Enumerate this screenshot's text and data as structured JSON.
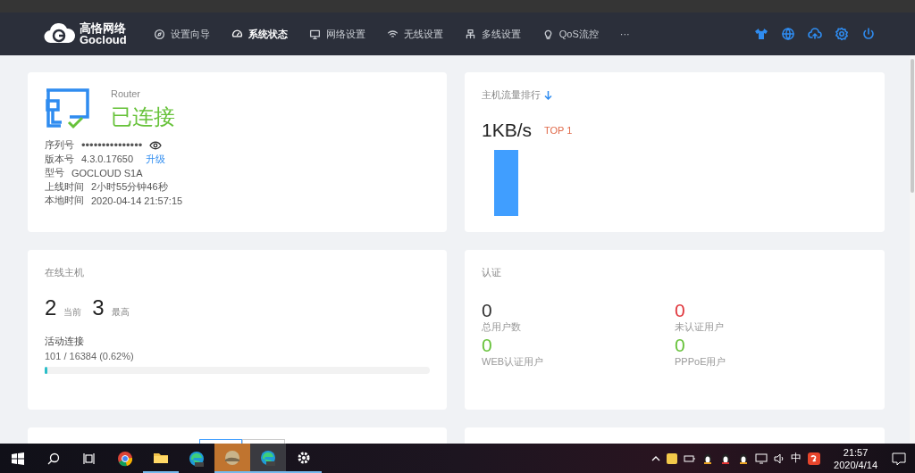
{
  "header": {
    "logo": {
      "title": "高恪网络",
      "subtitle": "Gocloud"
    },
    "nav": [
      {
        "label": "设置向导",
        "kind": "compass",
        "selected": false
      },
      {
        "label": "系统状态",
        "kind": "gauge",
        "selected": true
      },
      {
        "label": "网络设置",
        "kind": "monitor",
        "selected": false
      },
      {
        "label": "无线设置",
        "kind": "wifi",
        "selected": false
      },
      {
        "label": "多线设置",
        "kind": "network",
        "selected": false
      },
      {
        "label": "QoS流控",
        "kind": "bulb",
        "selected": false
      },
      {
        "label": "···",
        "kind": "more",
        "selected": false
      }
    ]
  },
  "router": {
    "device_type": "Router",
    "status": "已连接",
    "rows": [
      {
        "label": "序列号",
        "value": "•••••••••••••••",
        "kind": "secret"
      },
      {
        "label": "版本号",
        "value": "4.3.0.17650",
        "kind": "link",
        "link": "升级"
      },
      {
        "label": "型号",
        "value": "GOCLOUD S1A",
        "kind": "plain"
      },
      {
        "label": "上线时间",
        "value": "2小时55分钟46秒",
        "kind": "plain"
      },
      {
        "label": "本地时间",
        "value": "2020-04-14 21:57:15",
        "kind": "plain"
      }
    ]
  },
  "traffic": {
    "title": "主机流量排行",
    "speed": "1KB/s",
    "rank": "TOP 1"
  },
  "hosts": {
    "title": "在线主机",
    "current": "2",
    "current_label": "当前",
    "max": "3",
    "max_label": "最高",
    "connections": {
      "label": "活动连接",
      "reading": "101 / 16384 (0.62%)",
      "level": 0.0062
    }
  },
  "auth": {
    "title": "认证",
    "stats": [
      {
        "value": "0",
        "label": "总用户数",
        "color": "#333333"
      },
      {
        "value": "0",
        "label": "未认证用户",
        "color": "#e0383e"
      },
      {
        "value": "0",
        "label": "WEB认证用户",
        "color": "#67c23a"
      },
      {
        "value": "0",
        "label": "PPPoE用户",
        "color": "#67c23a"
      }
    ]
  },
  "taskbar": {
    "apps": [
      {
        "kind": "chrome",
        "running": false,
        "selected": false
      },
      {
        "kind": "folder",
        "running": true,
        "selected": false
      },
      {
        "kind": "edge",
        "running": false,
        "selected": false
      },
      {
        "kind": "photo",
        "running": true,
        "selected": true
      },
      {
        "kind": "edge",
        "running": true,
        "selected": false
      },
      {
        "kind": "gear",
        "running": true,
        "selected": false
      }
    ],
    "ime": "中",
    "time": "21:57",
    "date": "2020/4/14"
  }
}
